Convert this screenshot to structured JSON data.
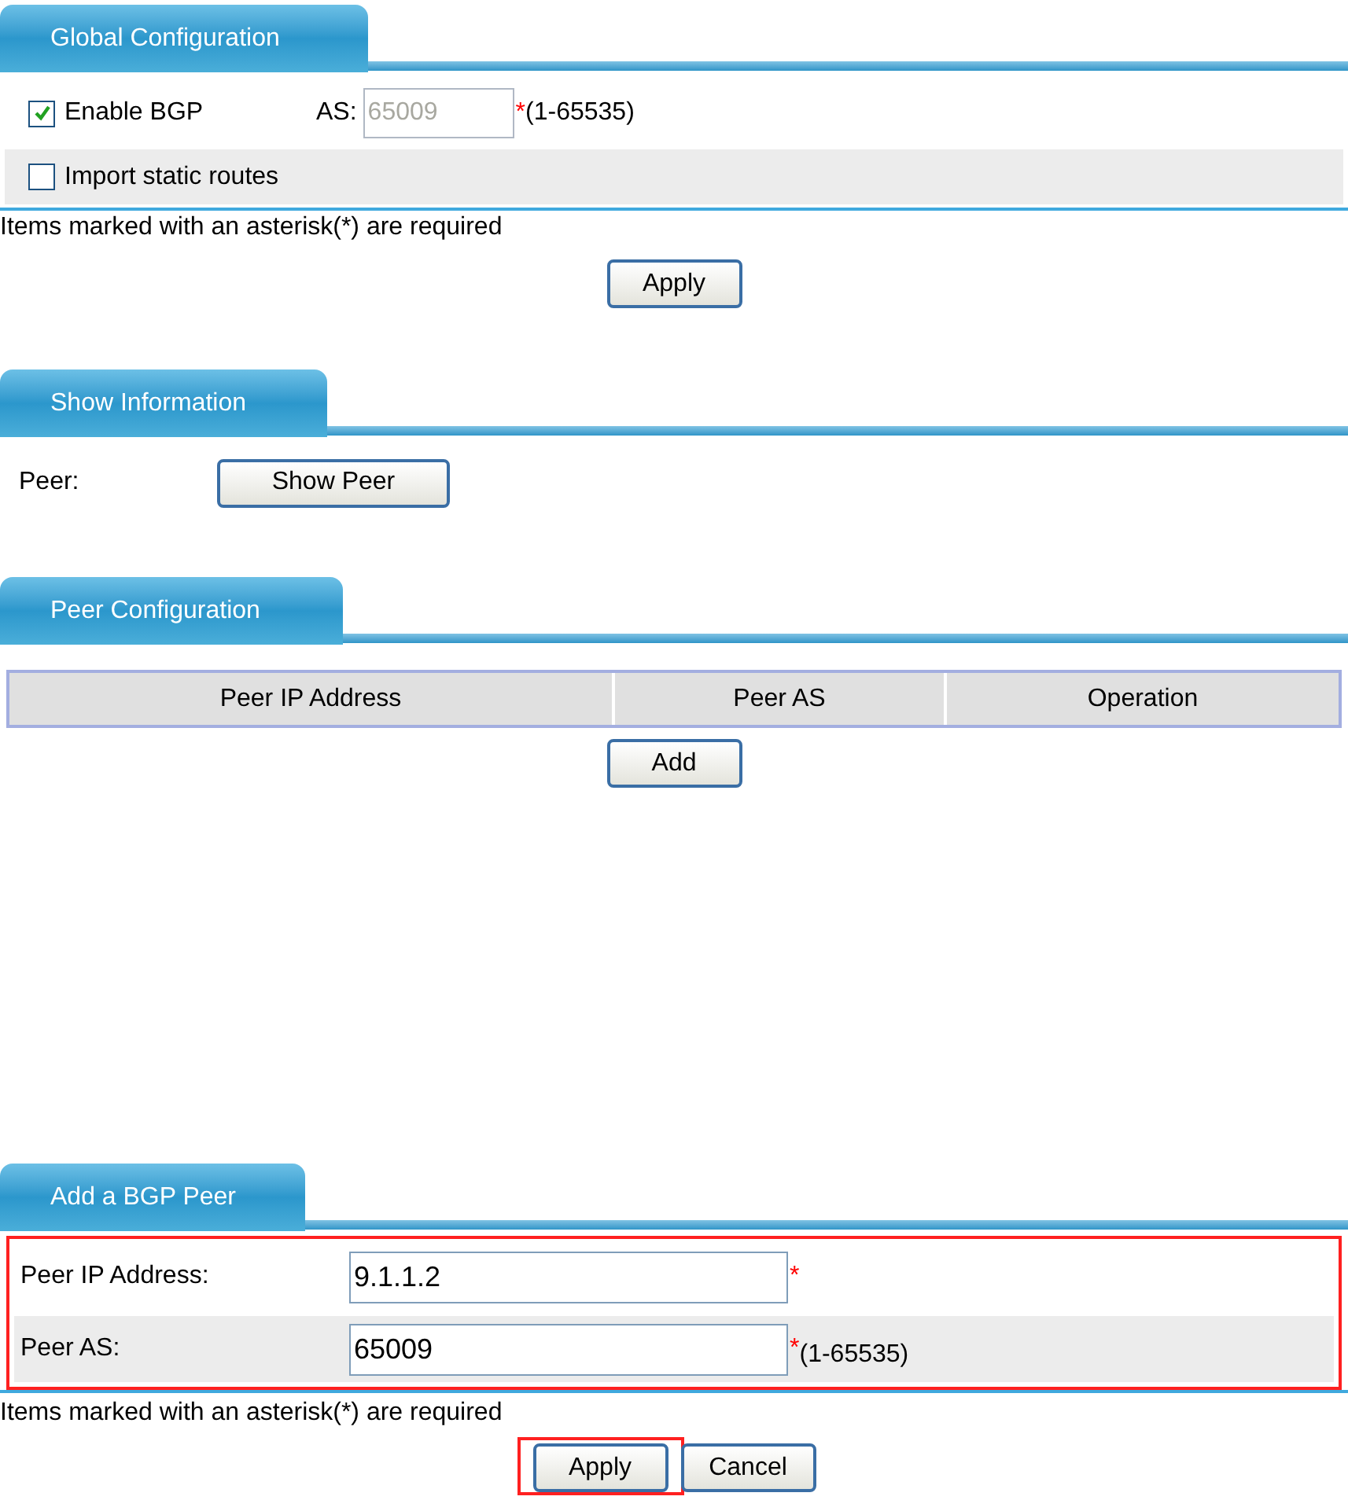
{
  "global_configuration": {
    "tab": "Global Configuration",
    "enable_bgp": {
      "label": "Enable BGP",
      "checked": true
    },
    "as_field": {
      "label": "AS:",
      "value": "65009",
      "disabled": true,
      "required_mark": "*",
      "range": "(1-65535)"
    },
    "import_static_routes": {
      "label": "Import static routes",
      "checked": false
    },
    "note": "Items marked with an asterisk(*) are required",
    "apply_button": "Apply"
  },
  "show_information": {
    "tab": "Show Information",
    "peer_label": "Peer:",
    "show_peer_button": "Show Peer"
  },
  "peer_configuration": {
    "tab": "Peer Configuration",
    "table": {
      "columns": [
        "Peer IP Address",
        "Peer AS",
        "Operation"
      ]
    },
    "add_button": "Add"
  },
  "add_bgp_peer": {
    "tab": "Add a BGP Peer",
    "highlighted": true,
    "fields": [
      {
        "label": "Peer IP Address:",
        "value": "9.1.1.2",
        "required_mark": "*"
      },
      {
        "label": "Peer AS:",
        "value": "65009",
        "required_mark": "*",
        "range": "(1-65535)"
      }
    ],
    "note": "Items marked with an asterisk(*) are required",
    "buttons": [
      {
        "label": "Apply",
        "highlighted": true
      },
      {
        "label": "Cancel",
        "highlighted": false
      }
    ]
  }
}
